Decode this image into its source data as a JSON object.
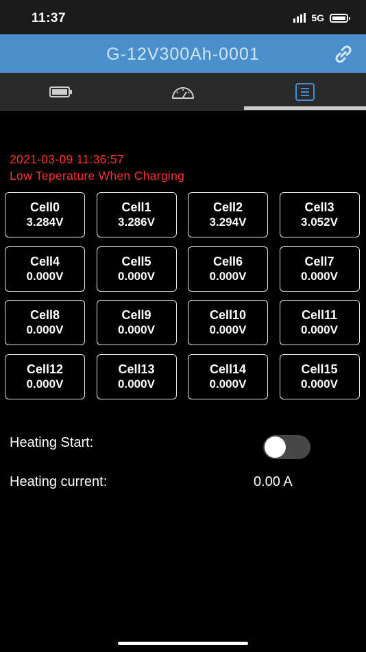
{
  "status_bar": {
    "time": "11:37",
    "network": "5G"
  },
  "header": {
    "title": "G-12V300Ah-0001"
  },
  "tabs": [
    {
      "icon": "battery-icon",
      "active": false
    },
    {
      "icon": "gauge-icon",
      "active": false
    },
    {
      "icon": "list-icon",
      "active": true
    }
  ],
  "alarm": {
    "timestamp": "2021-03-09 11:36:57",
    "message": "Low Teperature When Charging",
    "color": "#ff2f2f"
  },
  "cells": [
    {
      "name": "Cell0",
      "voltage": "3.284V"
    },
    {
      "name": "Cell1",
      "voltage": "3.286V"
    },
    {
      "name": "Cell2",
      "voltage": "3.294V"
    },
    {
      "name": "Cell3",
      "voltage": "3.052V"
    },
    {
      "name": "Cell4",
      "voltage": "0.000V"
    },
    {
      "name": "Cell5",
      "voltage": "0.000V"
    },
    {
      "name": "Cell6",
      "voltage": "0.000V"
    },
    {
      "name": "Cell7",
      "voltage": "0.000V"
    },
    {
      "name": "Cell8",
      "voltage": "0.000V"
    },
    {
      "name": "Cell9",
      "voltage": "0.000V"
    },
    {
      "name": "Cell10",
      "voltage": "0.000V"
    },
    {
      "name": "Cell11",
      "voltage": "0.000V"
    },
    {
      "name": "Cell12",
      "voltage": "0.000V"
    },
    {
      "name": "Cell13",
      "voltage": "0.000V"
    },
    {
      "name": "Cell14",
      "voltage": "0.000V"
    },
    {
      "name": "Cell15",
      "voltage": "0.000V"
    }
  ],
  "heating": {
    "start_label": "Heating Start:",
    "start_on": false,
    "current_label": "Heating current:",
    "current_value": "0.00 A"
  },
  "colors": {
    "header": "#4a8fcb",
    "tab_bar": "#2a2a2a",
    "active_tab": "#4a8fcb"
  }
}
